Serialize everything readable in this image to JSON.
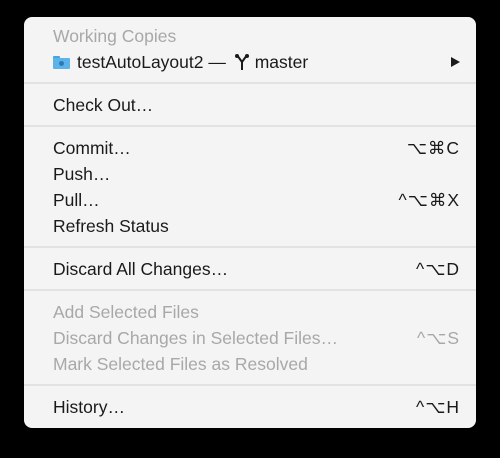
{
  "menu": {
    "working_copies_header": "Working Copies",
    "repo_name": "testAutoLayout2",
    "repo_separator": "—",
    "branch_name": "master",
    "items": [
      {
        "label": "Check Out…",
        "shortcut": ""
      },
      {
        "label": "Commit…",
        "shortcut": "⌥⌘C"
      },
      {
        "label": "Push…",
        "shortcut": ""
      },
      {
        "label": "Pull…",
        "shortcut": "^⌥⌘X"
      },
      {
        "label": "Refresh Status",
        "shortcut": ""
      },
      {
        "label": "Discard All Changes…",
        "shortcut": "^⌥D"
      },
      {
        "label": "Add Selected Files",
        "shortcut": "",
        "disabled": true
      },
      {
        "label": "Discard Changes in Selected Files…",
        "shortcut": "^⌥S",
        "disabled": true
      },
      {
        "label": "Mark Selected Files as Resolved",
        "shortcut": "",
        "disabled": true
      },
      {
        "label": "History…",
        "shortcut": "^⌥H"
      }
    ]
  },
  "icons": {
    "folder": "folder-icon",
    "branch": "branch-icon",
    "submenu": "submenu-arrow-icon"
  },
  "colors": {
    "menu_background": "#f4f4f4",
    "text": "#1a1a1a",
    "disabled_text": "#a8a8a8",
    "folder_blue": "#5cb3ea"
  }
}
